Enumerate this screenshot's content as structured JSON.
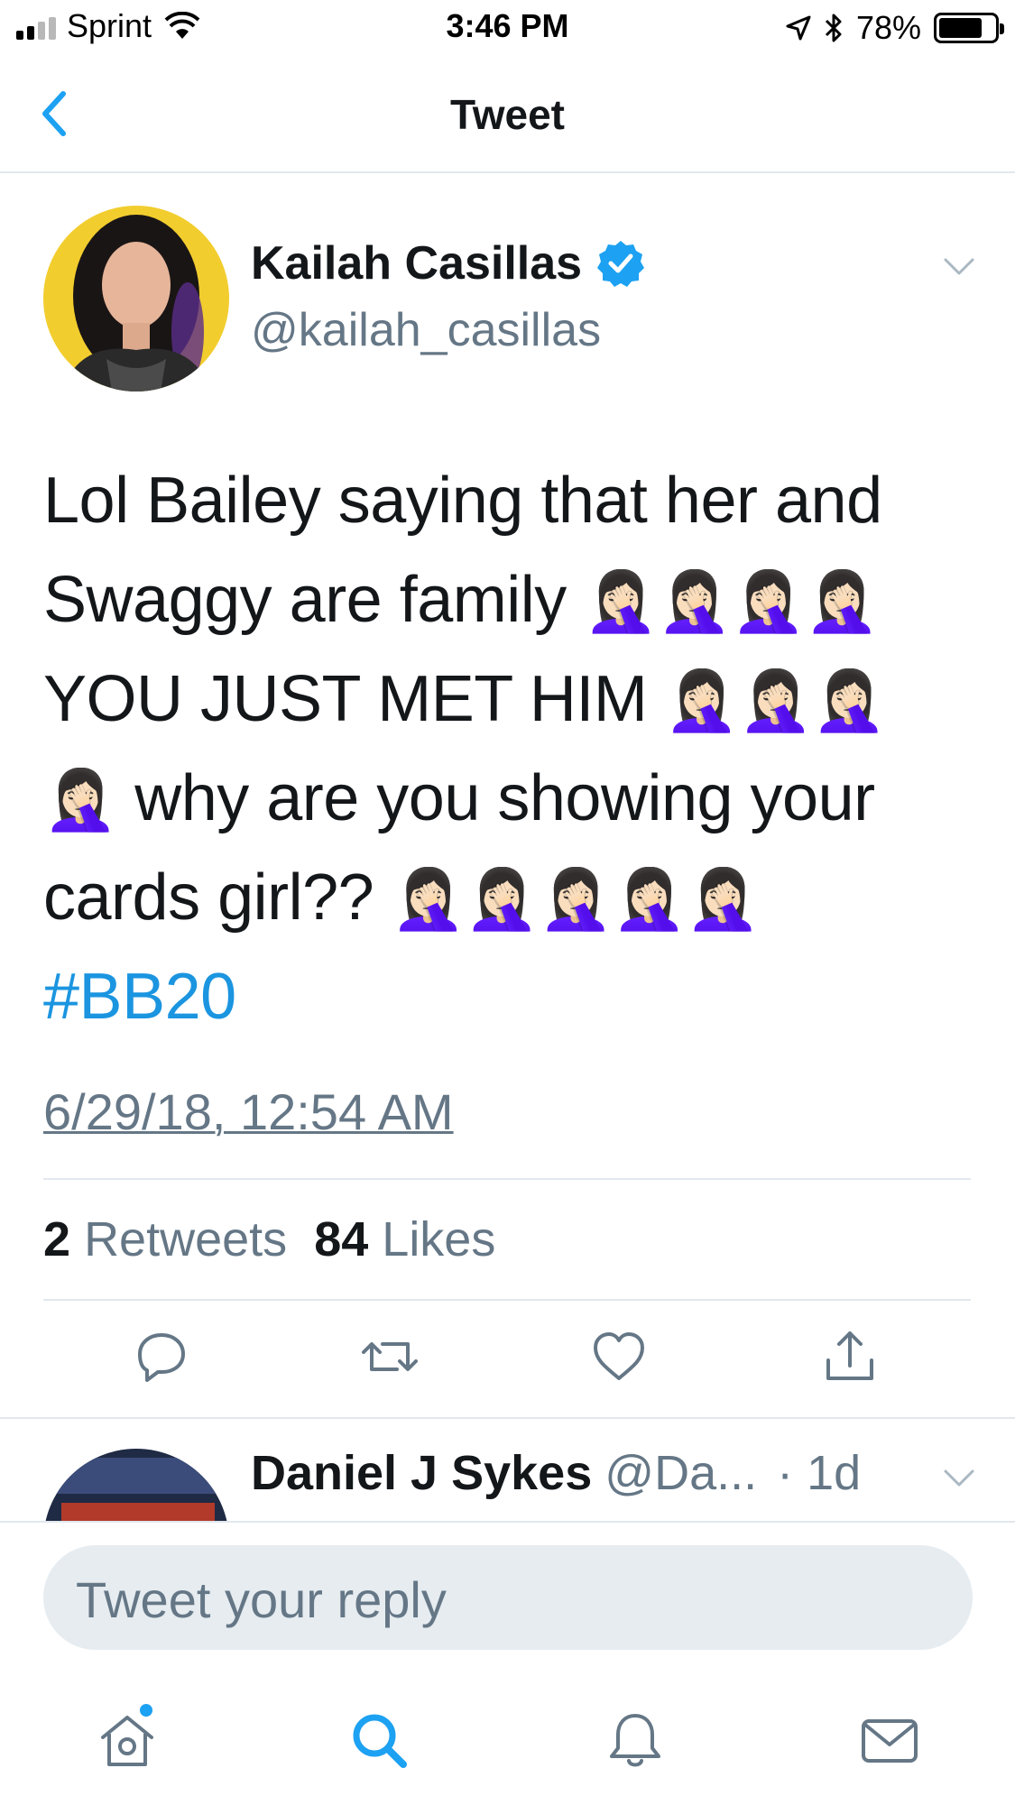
{
  "status_bar": {
    "carrier": "Sprint",
    "time": "3:46 PM",
    "battery": "78%",
    "battery_level": 0.78
  },
  "nav": {
    "title": "Tweet",
    "back_icon": "chevron-left-icon"
  },
  "tweet": {
    "author_name": "Kailah Casillas",
    "handle": "@kailah_casillas",
    "verified": true,
    "lines": [
      "Lol Bailey saying that her and",
      "Swaggy are family ",
      "YOU JUST MET HIM ",
      " why are you showing your",
      "cards girl?? "
    ],
    "emoji_runs": [
      "🤦🏻‍♀️🤦🏻‍♀️🤦🏻‍♀️🤦🏻‍♀️",
      "🤦🏻‍♀️🤦🏻‍♀️🤦🏻‍♀️",
      "🤦🏻‍♀️",
      "🤦🏻‍♀️🤦🏻‍♀️🤦🏻‍♀️🤦🏻‍♀️🤦🏻‍♀️"
    ],
    "hashtag": "#BB20",
    "timestamp": "6/29/18, 12:54 AM",
    "retweets_count": "2",
    "retweets_label": "Retweets",
    "likes_count": "84",
    "likes_label": "Likes"
  },
  "actions": [
    "reply-icon",
    "retweet-icon",
    "like-icon",
    "share-icon"
  ],
  "reply": {
    "author_name": "Daniel J Sykes",
    "handle": "@Da...",
    "time": "· 1d"
  },
  "compose": {
    "placeholder": "Tweet your reply"
  },
  "tabbar": [
    "home-icon",
    "search-icon",
    "notifications-icon",
    "messages-icon"
  ],
  "colors": {
    "accent": "#1da1f2",
    "hashtag": "#1b95e0",
    "secondary_text": "#657786",
    "divider": "#e1e8ed",
    "compose_bg": "#e6ecf0"
  }
}
